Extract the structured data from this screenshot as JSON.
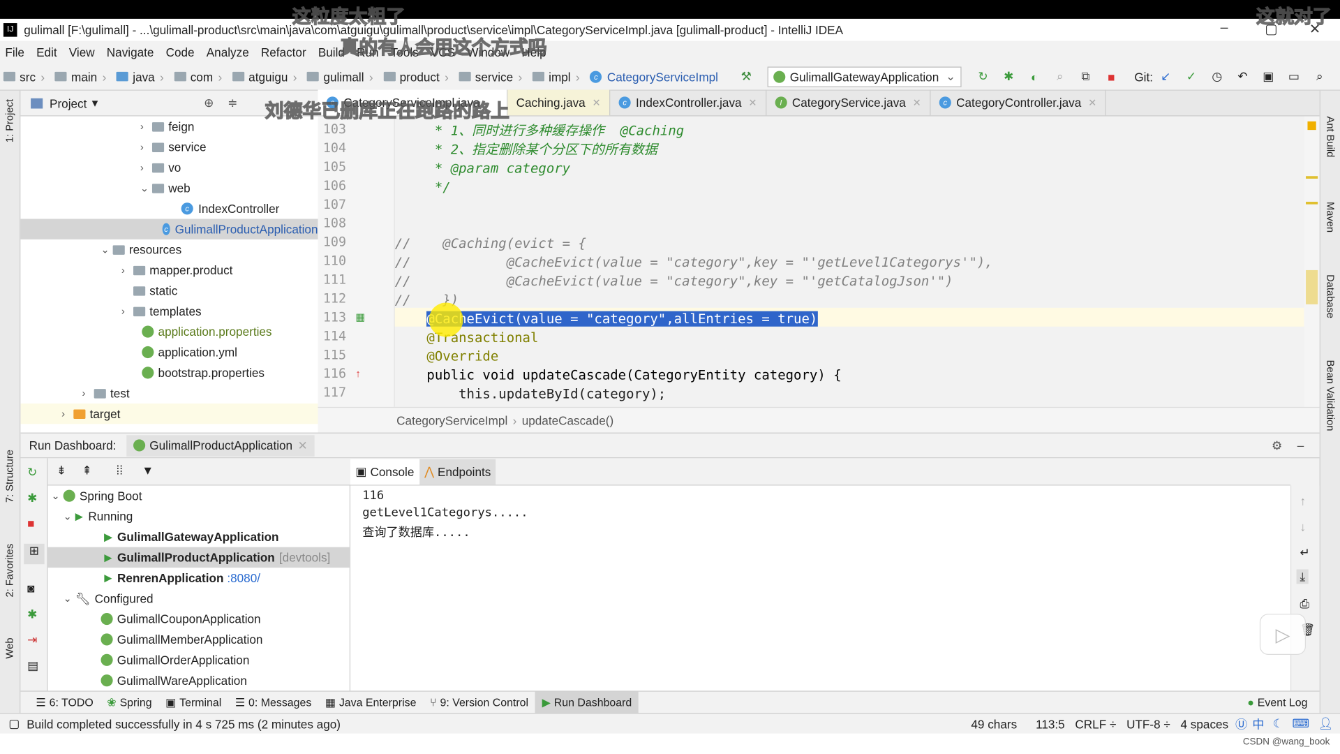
{
  "window": {
    "title": "gulimall [F:\\gulimall] - ...\\gulimall-product\\src\\main\\java\\com\\atguigu\\gulimall\\product\\service\\impl\\CategoryServiceImpl.java [gulimall-product] - IntelliJ IDEA",
    "logo": "IJ"
  },
  "overlays": [
    "这粒度太粗了",
    "真的有人会用这个方式吗",
    "这就对了",
    "刘德华已删库正在跑路的路上"
  ],
  "menu": [
    "File",
    "Edit",
    "View",
    "Navigate",
    "Code",
    "Analyze",
    "Refactor",
    "Build",
    "Run",
    "Tools",
    "VCS",
    "Window",
    "Help"
  ],
  "breadcrumb": [
    "src",
    "main",
    "java",
    "com",
    "atguigu",
    "gulimall",
    "product",
    "service",
    "impl",
    "CategoryServiceImpl"
  ],
  "toolbar": {
    "run_config": "GulimallGatewayApplication",
    "git_label": "Git:"
  },
  "left_strip": {
    "project": "1: Project",
    "structure": "7: Structure",
    "favorites": "2: Favorites",
    "web": "Web"
  },
  "right_strip": [
    "Ant Build",
    "Maven",
    "Database",
    "Bean Validation"
  ],
  "project_panel": {
    "title": "Project",
    "items": [
      {
        "label": "feign",
        "type": "folder"
      },
      {
        "label": "service",
        "type": "folder"
      },
      {
        "label": "vo",
        "type": "folder"
      },
      {
        "label": "web",
        "type": "folder"
      },
      {
        "label": "IndexController",
        "type": "class"
      },
      {
        "label": "GulimallProductApplication",
        "type": "spring-class"
      },
      {
        "label": "resources",
        "type": "folder"
      },
      {
        "label": "mapper.product",
        "type": "folder"
      },
      {
        "label": "static",
        "type": "folder"
      },
      {
        "label": "templates",
        "type": "folder"
      },
      {
        "label": "application.properties",
        "type": "config"
      },
      {
        "label": "application.yml",
        "type": "config"
      },
      {
        "label": "bootstrap.properties",
        "type": "config"
      },
      {
        "label": "test",
        "type": "folder"
      },
      {
        "label": "target",
        "type": "folder-orange"
      }
    ]
  },
  "editor_tabs": [
    {
      "label": "CategoryServiceImpl.java",
      "active": true
    },
    {
      "label": "Caching.java"
    },
    {
      "label": "IndexController.java"
    },
    {
      "label": "CategoryService.java"
    },
    {
      "label": "CategoryController.java"
    }
  ],
  "code": {
    "line_numbers": [
      "103",
      "104",
      "105",
      "106",
      "107",
      "108",
      "109",
      "110",
      "111",
      "112",
      "113",
      "114",
      "115",
      "116",
      "117"
    ],
    "lines": [
      "     * 1、同时进行多种缓存操作  @Caching",
      "     * 2、指定删除某个分区下的所有数据",
      "     * @param category",
      "     */",
      "",
      "",
      "//    @Caching(evict = {",
      "//            @CacheEvict(value = \"category\",key = \"'getLevel1Categorys'\"),",
      "//            @CacheEvict(value = \"category\",key = \"'getCatalogJson'\")",
      "//    })",
      "    @CacheEvict(value = \"category\",allEntries = true)",
      "    @Transactional",
      "    @Override",
      "    public void updateCascade(CategoryEntity category) {",
      "        this.updateById(category);"
    ]
  },
  "editor_breadcrumb": [
    "CategoryServiceImpl",
    "updateCascade()"
  ],
  "run_dashboard": {
    "label": "Run Dashboard:",
    "tab": "GulimallProductApplication",
    "tree": [
      {
        "label": "Spring Boot",
        "level": 0
      },
      {
        "label": "Running",
        "level": 1
      },
      {
        "label": "GulimallGatewayApplication",
        "level": 2,
        "bold": true
      },
      {
        "label": "GulimallProductApplication",
        "level": 2,
        "bold": true,
        "suffix": "[devtools]",
        "selected": true
      },
      {
        "label": "RenrenApplication",
        "level": 2,
        "bold": true,
        "suffix": ":8080/"
      },
      {
        "label": "Configured",
        "level": 1
      },
      {
        "label": "GulimallCouponApplication",
        "level": 2
      },
      {
        "label": "GulimallMemberApplication",
        "level": 2
      },
      {
        "label": "GulimallOrderApplication",
        "level": 2
      },
      {
        "label": "GulimallWareApplication",
        "level": 2
      }
    ],
    "console_tabs": [
      "Console",
      "Endpoints"
    ],
    "console_lines": [
      "116",
      "getLevel1Categorys.....",
      "查询了数据库....."
    ]
  },
  "tool_windows": [
    "6: TODO",
    "Spring",
    "Terminal",
    "0: Messages",
    "Java Enterprise",
    "9: Version Control",
    "Run Dashboard",
    "Event Log"
  ],
  "status": {
    "message": "Build completed successfully in 4 s 725 ms (2 minutes ago)",
    "chars": "49 chars",
    "position": "113:5",
    "line_sep": "CRLF ÷",
    "encoding": "UTF-8 ÷",
    "indent": "4 spaces",
    "watermark": "CSDN @wang_book",
    "ime": "中"
  }
}
